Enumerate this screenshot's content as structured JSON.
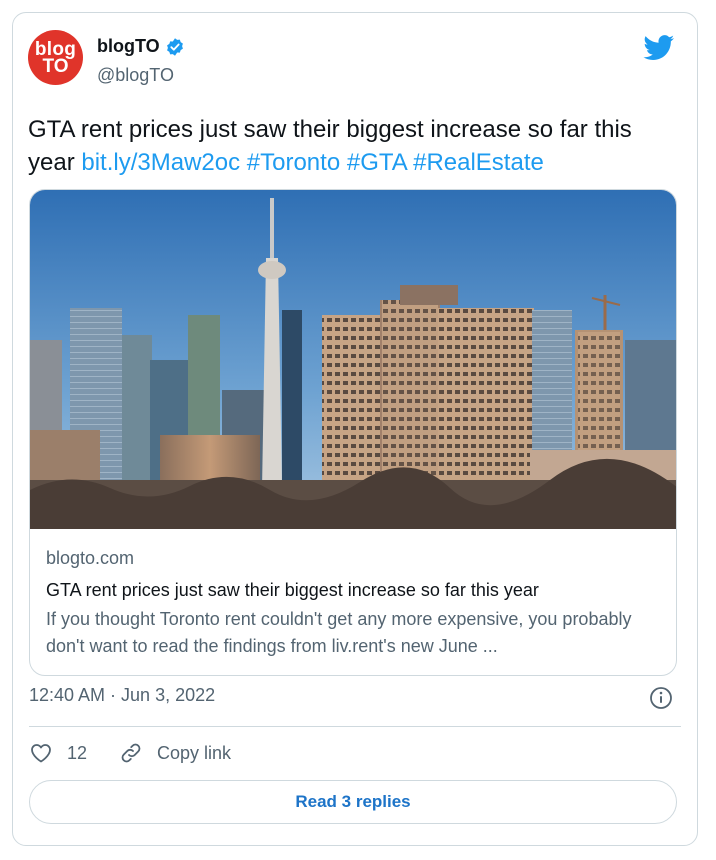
{
  "author": {
    "avatar_line1": "blog",
    "avatar_line2": "TO",
    "name": "blogTO",
    "handle": "@blogTO",
    "verified_icon": "verified-badge-icon",
    "platform_icon": "twitter-bird-icon"
  },
  "tweet": {
    "text": "GTA rent prices just saw their biggest increase so far this year ",
    "link": "bit.ly/3Maw2oc",
    "hashtags": [
      "#Toronto",
      "#GTA",
      "#RealEstate"
    ]
  },
  "preview": {
    "domain": "blogto.com",
    "title": "GTA rent prices just saw their biggest increase so far this year",
    "description": "If you thought Toronto rent couldn't get any more expensive, you probably don't want to read the findings from liv.rent's new June ..."
  },
  "meta": {
    "timestamp": "12:40 AM · Jun 3, 2022"
  },
  "actions": {
    "like_count": "12",
    "copy_link_label": "Copy link"
  },
  "read_replies_label": "Read 3 replies",
  "colors": {
    "accent": "#1d9bf0",
    "brand_red": "#e0342a",
    "muted": "#536471",
    "border": "#cfd9de"
  }
}
